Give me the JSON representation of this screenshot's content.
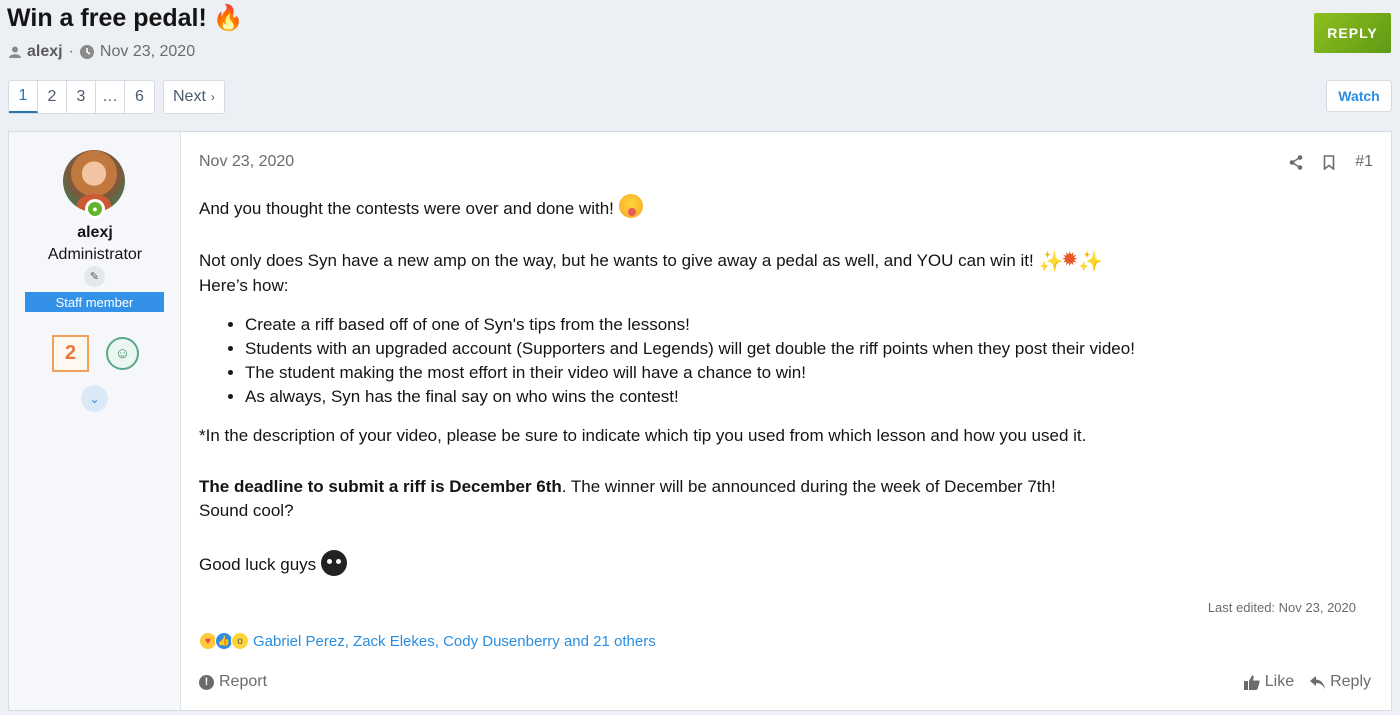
{
  "thread": {
    "title": "Win a free pedal!",
    "title_emoji": "🔥",
    "author": "alexj",
    "separator": "·",
    "date": "Nov 23, 2020",
    "reply_label": "REPLY",
    "watch_label": "Watch"
  },
  "pagination": {
    "pages": [
      "1",
      "2",
      "3",
      "…",
      "6"
    ],
    "active": "1",
    "next_label": "Next",
    "next_arrow": "›"
  },
  "user": {
    "name": "alexj",
    "role": "Administrator",
    "staff_label": "Staff member",
    "trophy_count": "2"
  },
  "post": {
    "date": "Nov 23, 2020",
    "number": "#1",
    "p1": "And you thought the contests were over and done with!",
    "p2": "Not only does Syn have a new amp on the way, but he wants to give away a pedal as well, and YOU can win it!",
    "p3": "Here’s how:",
    "bullets": [
      "Create a riff based off of one of Syn's tips from the lessons!",
      "Students with an upgraded account (Supporters and Legends) will get double the riff points when they post their video!",
      "The student making the most effort in their video will have a chance to win!",
      "As always, Syn has the final say on who wins the contest!"
    ],
    "p4": "*In the description of your video, please be sure to indicate which tip you used from which lesson and how you used it.",
    "p5_bold": "The deadline to submit a riff is December 6th",
    "p5_rest": ". The winner will be announced during the week of December 7th!",
    "p6": "Sound cool?",
    "p7": "Good luck guys",
    "last_edited": "Last edited: Nov 23, 2020",
    "reactions_text": "Gabriel Perez, Zack Elekes, Cody Dusenberry and 21 others",
    "report_label": "Report",
    "like_label": "Like",
    "reply_label": "Reply"
  }
}
